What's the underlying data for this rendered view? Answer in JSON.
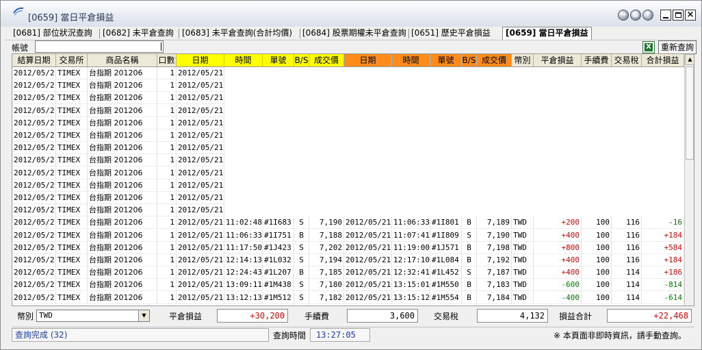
{
  "window": {
    "title": "[0659] 當日平倉損益"
  },
  "tabs": [
    {
      "label": "[0681] 部位狀況查詢",
      "active": false
    },
    {
      "label": "[0682] 未平倉查詢",
      "active": false
    },
    {
      "label": "[0683] 未平倉查詢(合計均價)",
      "active": false
    },
    {
      "label": "[0684] 股票期權未平倉查詢",
      "active": false
    },
    {
      "label": "[0651] 歷史平倉損益",
      "active": false
    },
    {
      "label": "[0659] 當日平倉損益",
      "active": true
    }
  ],
  "toolbar": {
    "account_label": "帳號",
    "account_value": "",
    "requery_label": "重新查詢"
  },
  "table": {
    "headers": [
      "結算日期",
      "交易所",
      "商品名稱",
      "口數",
      "日期",
      "時間",
      "單號",
      "B/S",
      "成交價",
      "日期",
      "時間",
      "單號",
      "B/S",
      "成交價",
      "幣別",
      "平倉損益",
      "手續費",
      "交易稅",
      "合計損益"
    ],
    "rows": [
      [
        "2012/05/21",
        "TIMEX",
        "台指期 201206",
        "1",
        "2012/05/21",
        "",
        "",
        "",
        "",
        "",
        "",
        "",
        "",
        "",
        "",
        "",
        "",
        "",
        ""
      ],
      [
        "2012/05/21",
        "TIMEX",
        "台指期 201206",
        "1",
        "2012/05/21",
        "",
        "",
        "",
        "",
        "",
        "",
        "",
        "",
        "",
        "",
        "",
        "",
        "",
        ""
      ],
      [
        "2012/05/21",
        "TIMEX",
        "台指期 201206",
        "1",
        "2012/05/21",
        "",
        "",
        "",
        "",
        "",
        "",
        "",
        "",
        "",
        "",
        "",
        "",
        "",
        ""
      ],
      [
        "2012/05/21",
        "TIMEX",
        "台指期 201206",
        "1",
        "2012/05/21",
        "",
        "",
        "",
        "",
        "",
        "",
        "",
        "",
        "",
        "",
        "",
        "",
        "",
        ""
      ],
      [
        "2012/05/21",
        "TIMEX",
        "台指期 201206",
        "1",
        "2012/05/21",
        "",
        "",
        "",
        "",
        "",
        "",
        "",
        "",
        "",
        "",
        "",
        "",
        "",
        ""
      ],
      [
        "2012/05/21",
        "TIMEX",
        "台指期 201206",
        "1",
        "2012/05/21",
        "",
        "",
        "",
        "",
        "",
        "",
        "",
        "",
        "",
        "",
        "",
        "",
        "",
        ""
      ],
      [
        "2012/05/21",
        "TIMEX",
        "台指期 201206",
        "1",
        "2012/05/21",
        "",
        "",
        "",
        "",
        "",
        "",
        "",
        "",
        "",
        "",
        "",
        "",
        "",
        ""
      ],
      [
        "2012/05/21",
        "TIMEX",
        "台指期 201206",
        "1",
        "2012/05/21",
        "",
        "",
        "",
        "",
        "",
        "",
        "",
        "",
        "",
        "",
        "",
        "",
        "",
        ""
      ],
      [
        "2012/05/21",
        "TIMEX",
        "台指期 201206",
        "1",
        "2012/05/21",
        "",
        "",
        "",
        "",
        "",
        "",
        "",
        "",
        "",
        "",
        "",
        "",
        "",
        ""
      ],
      [
        "2012/05/21",
        "TIMEX",
        "台指期 201206",
        "1",
        "2012/05/21",
        "",
        "",
        "",
        "",
        "",
        "",
        "",
        "",
        "",
        "",
        "",
        "",
        "",
        ""
      ],
      [
        "2012/05/21",
        "TIMEX",
        "台指期 201206",
        "1",
        "2012/05/21",
        "",
        "",
        "",
        "",
        "",
        "",
        "",
        "",
        "",
        "",
        "",
        "",
        "",
        ""
      ],
      [
        "2012/05/21",
        "TIMEX",
        "台指期 201206",
        "1",
        "2012/05/21",
        "",
        "",
        "",
        "",
        "",
        "",
        "",
        "",
        "",
        "",
        "",
        "",
        "",
        ""
      ],
      [
        "2012/05/21",
        "TIMEX",
        "台指期 201206",
        "1",
        "2012/05/21",
        "11:02:48",
        "#1I683",
        "S",
        "7,190",
        "2012/05/21",
        "11:06:33",
        "#1I801",
        "B",
        "7,189",
        "TWD",
        "+200",
        "100",
        "116",
        "-16"
      ],
      [
        "2012/05/21",
        "TIMEX",
        "台指期 201206",
        "1",
        "2012/05/21",
        "11:06:33",
        "#1I751",
        "B",
        "7,188",
        "2012/05/21",
        "11:07:41",
        "#1I809",
        "S",
        "7,190",
        "TWD",
        "+400",
        "100",
        "116",
        "+184"
      ],
      [
        "2012/05/21",
        "TIMEX",
        "台指期 201206",
        "1",
        "2012/05/21",
        "11:17:50",
        "#1J423",
        "S",
        "7,202",
        "2012/05/21",
        "11:19:00",
        "#1J571",
        "B",
        "7,198",
        "TWD",
        "+800",
        "100",
        "116",
        "+584"
      ],
      [
        "2012/05/21",
        "TIMEX",
        "台指期 201206",
        "1",
        "2012/05/21",
        "12:14:13",
        "#1L032",
        "S",
        "7,194",
        "2012/05/21",
        "12:17:10",
        "#1L084",
        "B",
        "7,192",
        "TWD",
        "+400",
        "100",
        "116",
        "+184"
      ],
      [
        "2012/05/21",
        "TIMEX",
        "台指期 201206",
        "1",
        "2012/05/21",
        "12:24:43",
        "#1L207",
        "B",
        "7,185",
        "2012/05/21",
        "12:32:41",
        "#1L452",
        "S",
        "7,187",
        "TWD",
        "+400",
        "100",
        "114",
        "+186"
      ],
      [
        "2012/05/21",
        "TIMEX",
        "台指期 201206",
        "1",
        "2012/05/21",
        "13:09:11",
        "#1M438",
        "S",
        "7,180",
        "2012/05/21",
        "13:15:01",
        "#1M550",
        "B",
        "7,183",
        "TWD",
        "-600",
        "100",
        "114",
        "-814"
      ],
      [
        "2012/05/21",
        "TIMEX",
        "台指期 201206",
        "1",
        "2012/05/21",
        "13:12:13",
        "#1M512",
        "S",
        "7,182",
        "2012/05/21",
        "13:15:12",
        "#1M554",
        "B",
        "7,184",
        "TWD",
        "-400",
        "100",
        "114",
        "-614"
      ]
    ]
  },
  "summary": {
    "currency_label": "幣別",
    "currency_value": "TWD",
    "pnl_label": "平倉損益",
    "pnl_value": "+30,200",
    "fee_label": "手續費",
    "fee_value": "3,600",
    "tax_label": "交易稅",
    "tax_value": "4,132",
    "total_label": "損益合計",
    "total_value": "+22,468"
  },
  "status": {
    "message": "查詢完成 (32)",
    "query_time_label": "查詢時間",
    "query_time_value": "13:27:05",
    "note": "※ 本頁面非即時資訊，請手動查詢。"
  },
  "colors": {
    "header_yellow": "#ffff00",
    "header_orange": "#ff8c1a",
    "profit": "#e00000",
    "loss": "#008000"
  }
}
